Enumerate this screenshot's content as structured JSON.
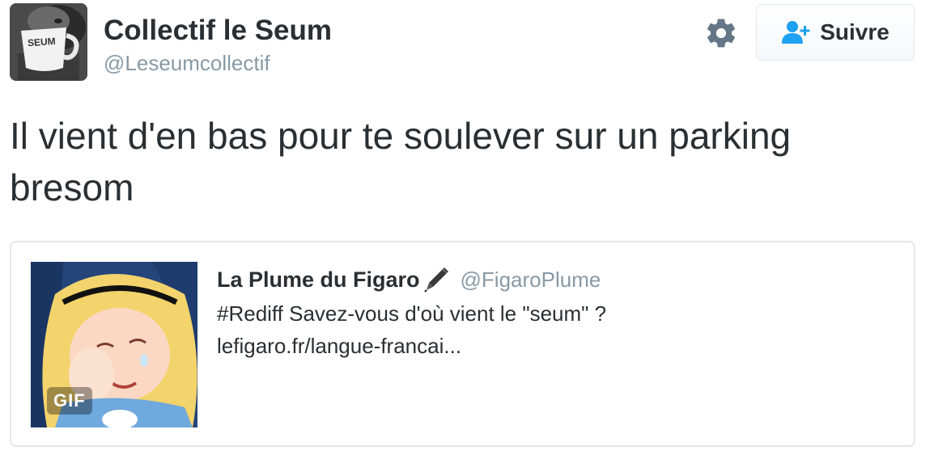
{
  "author": {
    "display_name": "Collectif le Seum",
    "handle": "@Leseumcollectif",
    "avatar_icon": "mug-avatar",
    "avatar_mug_text": "SEUM"
  },
  "actions": {
    "settings_icon": "gear-icon",
    "follow_icon": "add-user-icon",
    "follow_label": "Suivre"
  },
  "tweet": {
    "text": "Il vient d'en bas pour te soulever sur un parking bresom"
  },
  "quoted_tweet": {
    "display_name": "La Plume du Figaro",
    "name_emoji_icon": "pen-icon",
    "handle": "@FigaroPlume",
    "text_line1": "#Rediff Savez-vous d'où vient le \"seum\" ?",
    "text_line2": "lefigaro.fr/langue-francai...",
    "media_badge": "GIF"
  },
  "colors": {
    "text": "#292f33",
    "secondary_text": "#8899a6",
    "border": "#e1e8ed",
    "follow_icon": "#1da1f2",
    "gear": "#657786"
  }
}
